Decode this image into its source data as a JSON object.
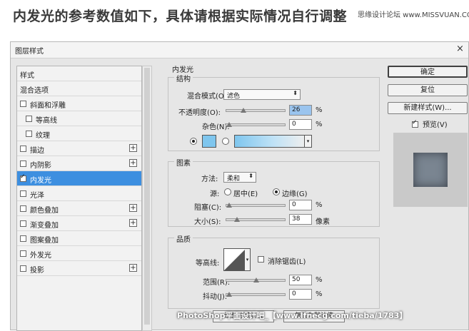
{
  "headline": "内发光的参考数值如下，具体请根据实际情况自行调整",
  "watermark_top": "思缘设计论坛 www.MISSVUAN.COM",
  "watermark_bottom": "PhotoShop平面设计吧_【www.lfnecg.com/tieba/1783】",
  "dialog": {
    "title": "图层样式",
    "close": "×"
  },
  "sidebar": {
    "items": [
      {
        "label": "样式",
        "checkbox": false,
        "checked": false,
        "plus": false,
        "selected": false
      },
      {
        "label": "混合选项",
        "checkbox": false,
        "checked": false,
        "plus": false,
        "selected": false
      },
      {
        "label": "斜面和浮雕",
        "checkbox": true,
        "checked": false,
        "plus": false,
        "selected": false
      },
      {
        "label": "等高线",
        "checkbox": true,
        "checked": false,
        "plus": false,
        "selected": false,
        "indent": true
      },
      {
        "label": "纹理",
        "checkbox": true,
        "checked": false,
        "plus": false,
        "selected": false,
        "indent": true
      },
      {
        "label": "描边",
        "checkbox": true,
        "checked": false,
        "plus": true,
        "selected": false
      },
      {
        "label": "内阴影",
        "checkbox": true,
        "checked": false,
        "plus": true,
        "selected": false
      },
      {
        "label": "内发光",
        "checkbox": true,
        "checked": true,
        "plus": false,
        "selected": true
      },
      {
        "label": "光泽",
        "checkbox": true,
        "checked": false,
        "plus": false,
        "selected": false
      },
      {
        "label": "颜色叠加",
        "checkbox": true,
        "checked": false,
        "plus": true,
        "selected": false
      },
      {
        "label": "渐变叠加",
        "checkbox": true,
        "checked": false,
        "plus": true,
        "selected": false
      },
      {
        "label": "图案叠加",
        "checkbox": true,
        "checked": false,
        "plus": false,
        "selected": false
      },
      {
        "label": "外发光",
        "checkbox": true,
        "checked": false,
        "plus": false,
        "selected": false
      },
      {
        "label": "投影",
        "checkbox": true,
        "checked": false,
        "plus": true,
        "selected": false
      }
    ]
  },
  "panel": {
    "section_title": "内发光",
    "structure": {
      "title": "结构",
      "blend_label": "混合模式(O):",
      "blend_value": "滤色",
      "opacity_label": "不透明度(O):",
      "opacity_value": "26",
      "opacity_level": 0.26,
      "noise_label": "杂色(N):",
      "noise_value": "0",
      "noise_level": 0,
      "unit": "%",
      "glow_color": "#7fc6ee"
    },
    "elements": {
      "title": "图素",
      "technique_label": "方法:",
      "technique_value": "柔和",
      "source_label": "源:",
      "source_center": "居中(E)",
      "source_edge": "边缘(G)",
      "choke_label": "阻塞(C):",
      "choke_value": "0",
      "choke_level": 0,
      "size_label": "大小(S):",
      "size_value": "38",
      "size_level": 0.15,
      "size_unit": "像素",
      "unit": "%"
    },
    "quality": {
      "title": "品质",
      "contour_label": "等高线:",
      "anti_alias_label": "消除锯齿(L)",
      "range_label": "范围(R):",
      "range_value": "50",
      "range_level": 0.5,
      "jitter_label": "抖动(J):",
      "jitter_value": "0",
      "jitter_level": 0,
      "unit": "%"
    },
    "buttons": {
      "set_default": "设置为默认值",
      "reset_default": "复位为默认值"
    }
  },
  "right_buttons": {
    "ok": "确定",
    "reset": "复位",
    "new_style": "新建样式(W)...",
    "preview": "预览(V)"
  }
}
